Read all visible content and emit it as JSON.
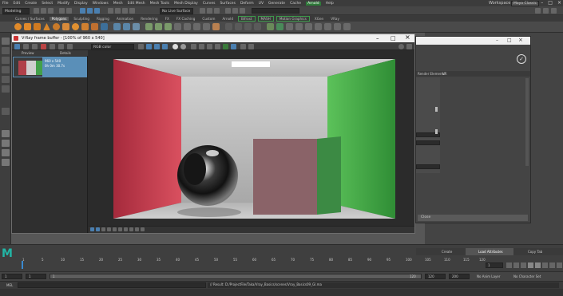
{
  "menubar": {
    "items": [
      "File",
      "Edit",
      "Create",
      "Select",
      "Modify",
      "Display",
      "Windows",
      "Mesh",
      "Edit Mesh",
      "Mesh Tools",
      "Mesh Display",
      "Curves",
      "Surfaces",
      "Deform",
      "UV",
      "Generate",
      "Cache",
      "Arnold",
      "Help"
    ],
    "highlight": "Arnold",
    "workspace_label": "Workspace:",
    "workspace_value": "Maya Classic"
  },
  "toolbar": {
    "mode_value": "Modeling",
    "live_surface": "No Live Surface"
  },
  "shelf_tabs": [
    "Curves / Surfaces",
    "Polygons",
    "Sculpting",
    "Rigging",
    "Animation",
    "Rendering",
    "FX",
    "FX Caching",
    "Custom",
    "Arnold",
    "Bifrost",
    "MASH",
    "Motion Graphics",
    "XGen",
    "VRay"
  ],
  "shelf_tabs_active": "Polygons",
  "vfb": {
    "title": "V-Ray frame buffer - [100% of 960 x 540]",
    "channel_value": "RGB color",
    "history_headers": [
      "Preview",
      "Details"
    ],
    "history_item_line1": "960 x 540",
    "history_item_line2": "0h 0m 30.7s"
  },
  "right_panel": {
    "tabs": [
      "Render Elements",
      "VR"
    ],
    "close_label": "Close"
  },
  "timeline": {
    "frame_labels": [
      "1",
      "5",
      "10",
      "15",
      "20",
      "25",
      "30",
      "35",
      "40",
      "45",
      "50",
      "55",
      "60",
      "65",
      "70",
      "75",
      "80",
      "85",
      "90",
      "95",
      "100",
      "105",
      "110",
      "115",
      "120"
    ],
    "current_frame": "1",
    "scene_tabs": [
      "Create",
      "Load Attributes",
      "Copy Tab"
    ],
    "logo_letter": "M"
  },
  "range": {
    "start": "1",
    "start2": "1",
    "range_start_field": "1",
    "range_end_field": "120",
    "end": "120",
    "end2": "200",
    "anim_layer": "No Anim Layer",
    "char_set": "No Character Set"
  },
  "cmdline": {
    "lang": "MEL",
    "result": "// Result: D:/ProjectFile/Taka/Vray_Basics/scenes/Vray_Basics09_GI.ma"
  },
  "colors": {
    "maya_teal": "#22b5a5",
    "arnold_green": "#2f7a3a",
    "history_selected": "#5a8fb8"
  },
  "icons": [
    "minimize-icon",
    "maximize-icon",
    "close-icon",
    "maya-logo-icon",
    "vray-logo-icon",
    "play-icon",
    "step-forward-icon",
    "step-back-icon"
  ]
}
